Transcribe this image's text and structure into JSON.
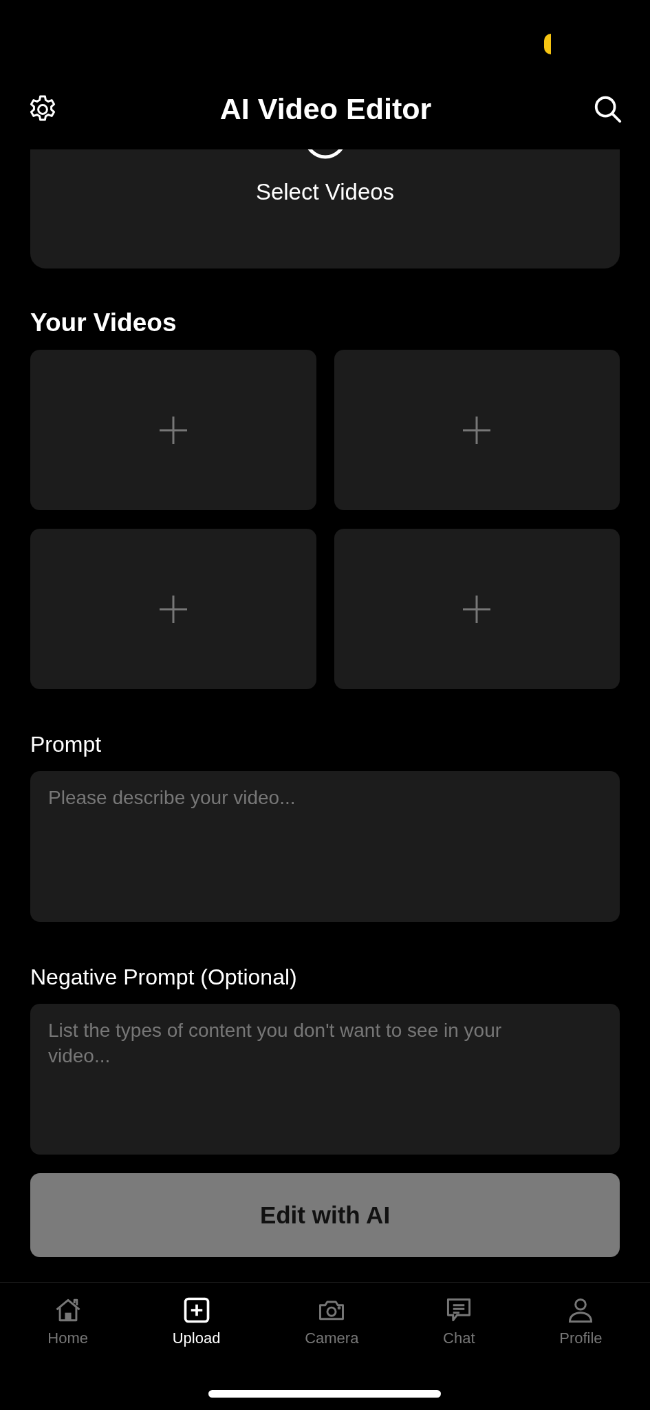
{
  "header": {
    "title": "AI Video Editor"
  },
  "upload_card": {
    "label": "Select Videos"
  },
  "videos_section": {
    "title": "Your Videos",
    "slots": [
      {
        "kind": "empty"
      },
      {
        "kind": "empty"
      },
      {
        "kind": "empty"
      },
      {
        "kind": "empty"
      }
    ]
  },
  "prompt": {
    "label": "Prompt",
    "placeholder": "Please describe your video..."
  },
  "negative_prompt": {
    "label": "Negative Prompt (Optional)",
    "placeholder": "List the types of content you don't want to see in your video..."
  },
  "submit_button": {
    "label": "Edit with AI",
    "disabled": true
  },
  "tab_bar": [
    {
      "label": "Home",
      "kind": "home",
      "selected": false
    },
    {
      "label": "Upload",
      "kind": "upload",
      "selected": true
    },
    {
      "label": "Camera",
      "kind": "camera",
      "selected": false
    },
    {
      "label": "Chat",
      "kind": "chat",
      "selected": false
    },
    {
      "label": "Profile",
      "kind": "profile",
      "selected": false
    }
  ]
}
